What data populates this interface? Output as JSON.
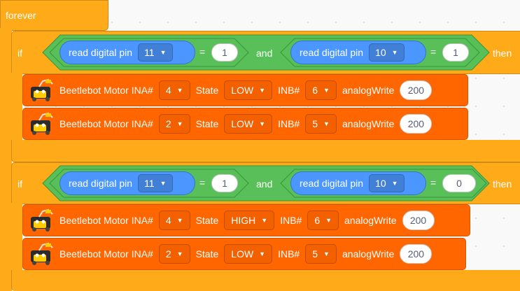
{
  "forever": {
    "label": "forever"
  },
  "blocks": [
    {
      "if_label": "if",
      "then_label": "then",
      "left": {
        "sensor": "read digital pin",
        "pin": "11",
        "op": "=",
        "value": "1"
      },
      "and_label": "and",
      "right": {
        "sensor": "read digital pin",
        "pin": "10",
        "op": "=",
        "value": "1"
      },
      "motors": [
        {
          "title": "Beetlebot Motor INA#",
          "ina": "4",
          "state_label": "State",
          "state": "LOW",
          "inb_label": "INB#",
          "inb": "6",
          "aw_label": "analogWrite",
          "aw": "200"
        },
        {
          "title": "Beetlebot Motor INA#",
          "ina": "2",
          "state_label": "State",
          "state": "LOW",
          "inb_label": "INB#",
          "inb": "5",
          "aw_label": "analogWrite",
          "aw": "200"
        }
      ]
    },
    {
      "if_label": "if",
      "then_label": "then",
      "left": {
        "sensor": "read digital pin",
        "pin": "11",
        "op": "=",
        "value": "1"
      },
      "and_label": "and",
      "right": {
        "sensor": "read digital pin",
        "pin": "10",
        "op": "=",
        "value": "0"
      },
      "motors": [
        {
          "title": "Beetlebot Motor INA#",
          "ina": "4",
          "state_label": "State",
          "state": "HIGH",
          "inb_label": "INB#",
          "inb": "6",
          "aw_label": "analogWrite",
          "aw": "200"
        },
        {
          "title": "Beetlebot Motor INA#",
          "ina": "2",
          "state_label": "State",
          "state": "LOW",
          "inb_label": "INB#",
          "inb": "5",
          "aw_label": "analogWrite",
          "aw": "200"
        }
      ]
    }
  ],
  "colors": {
    "control": "#ffab19",
    "operator": "#59c059",
    "sensor": "#4c97ff",
    "motor": "#ff6600"
  },
  "icons": {
    "dropdown": "caret-down-icon",
    "robot": "beetlebot-icon"
  }
}
